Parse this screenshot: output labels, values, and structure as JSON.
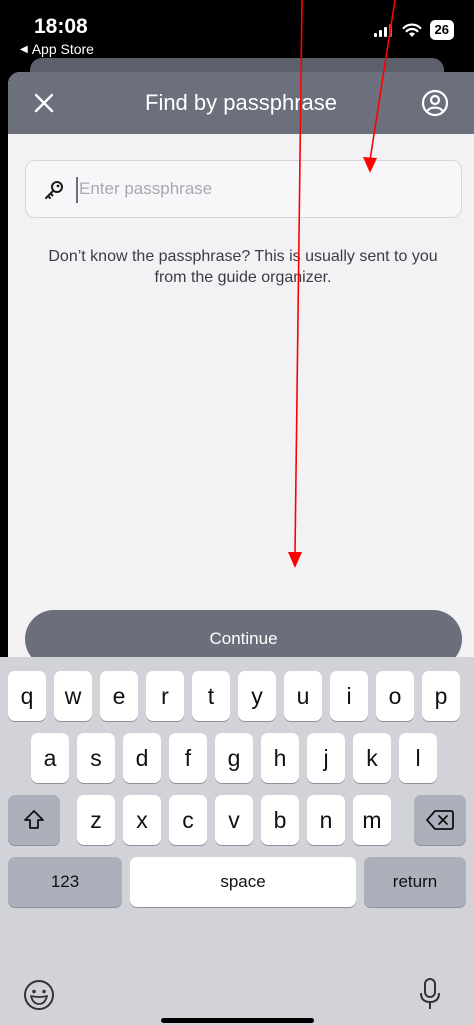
{
  "status_bar": {
    "time": "18:08",
    "back_label": "App Store",
    "battery": "26"
  },
  "header": {
    "title": "Find by passphrase",
    "close_icon": "close-icon",
    "profile_icon": "profile-icon"
  },
  "passphrase": {
    "placeholder": "Enter passphrase",
    "value": "",
    "icon": "key-icon"
  },
  "help_text": "Don’t know the passphrase? This is usually sent to you from the guide organizer.",
  "continue_label": "Continue",
  "keyboard": {
    "row1": [
      "q",
      "w",
      "e",
      "r",
      "t",
      "y",
      "u",
      "i",
      "o",
      "p"
    ],
    "row2": [
      "a",
      "s",
      "d",
      "f",
      "g",
      "h",
      "j",
      "k",
      "l"
    ],
    "row3": [
      "z",
      "x",
      "c",
      "v",
      "b",
      "n",
      "m"
    ],
    "numbers_label": "123",
    "space_label": "space",
    "return_label": "return"
  },
  "colors": {
    "header": "#6c707c",
    "button": "#6a6f7b",
    "sheet_bg": "#f2f2f4",
    "keyboard_bg": "#d1d3d9",
    "annotation": "#ff0000"
  }
}
